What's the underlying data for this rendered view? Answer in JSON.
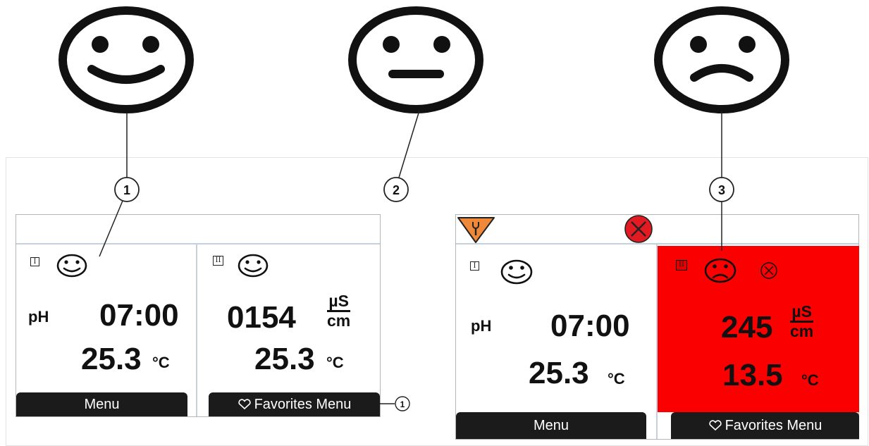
{
  "callouts": [
    "1",
    "2",
    "3"
  ],
  "footnote_callout": "1",
  "panel_left": {
    "channel1": {
      "channel_numeral": "I",
      "status": "happy-face-icon",
      "measurement_label": "pH",
      "value": "07:00",
      "temperature": "25.3",
      "temperature_unit": "°C",
      "button_label": "Menu"
    },
    "channel2": {
      "channel_numeral": "II",
      "status": "happy-face-icon",
      "value": "0154",
      "unit_numerator": "µS",
      "unit_denominator": "cm",
      "temperature": "25.3",
      "temperature_unit": "°C",
      "button_label": "Favorites Menu"
    }
  },
  "panel_right": {
    "topbar": {
      "maintenance_icon": "wrench-warning-icon",
      "failure_icon": "failure-x-icon"
    },
    "channel1": {
      "channel_numeral": "I",
      "status": "happy-face-icon",
      "measurement_label": "pH",
      "value": "07:00",
      "temperature": "25.3",
      "temperature_unit": "°C",
      "button_label": "Menu"
    },
    "channel2": {
      "channel_numeral": "II",
      "status": "sad-face-icon",
      "value": "245",
      "unit_numerator": "µS",
      "unit_denominator": "cm",
      "temperature": "13.5",
      "temperature_unit": "°C",
      "button_label": "Favorites Menu",
      "background_color": "#fa0000"
    }
  },
  "colors": {
    "alarm_red": "#fa0000",
    "failure_red": "#e21b23",
    "maintenance_orange": "#f0883a",
    "button_dark": "#1b1b1b",
    "divider_blue": "#c5d0dd"
  }
}
